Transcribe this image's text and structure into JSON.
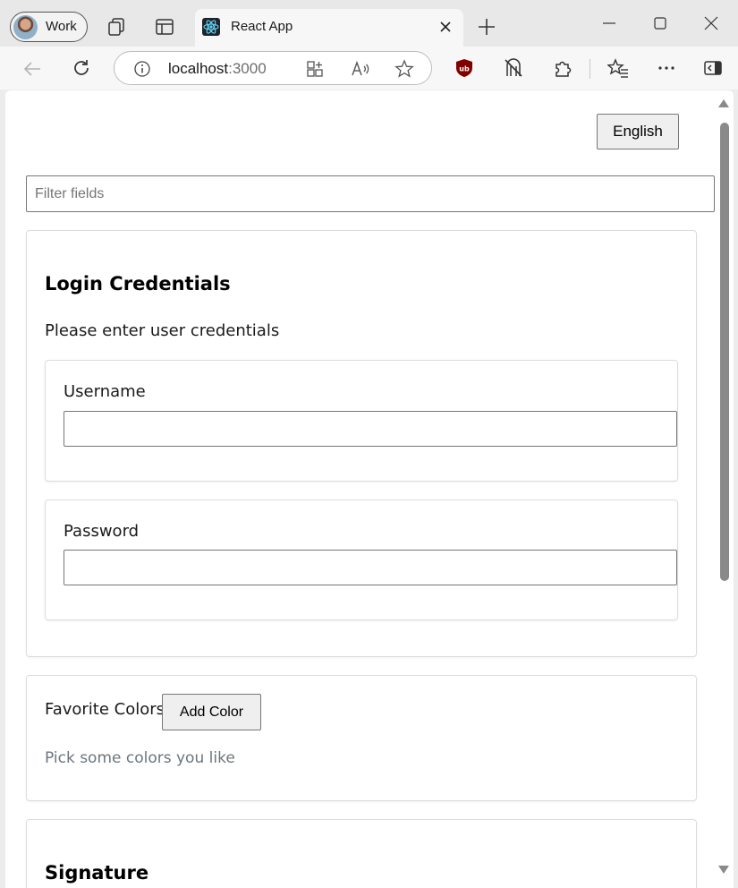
{
  "browser": {
    "profile_label": "Work",
    "tab_title": "React App",
    "url_host": "localhost",
    "url_port": ":3000"
  },
  "page": {
    "language_button": "English",
    "filter_placeholder": "Filter fields",
    "login": {
      "title": "Login Credentials",
      "description": "Please enter user credentials",
      "username_label": "Username",
      "password_label": "Password"
    },
    "colors": {
      "label": "Favorite Colors",
      "add_button": "Add Color",
      "help": "Pick some colors you like"
    },
    "signature": {
      "title": "Signature"
    }
  }
}
